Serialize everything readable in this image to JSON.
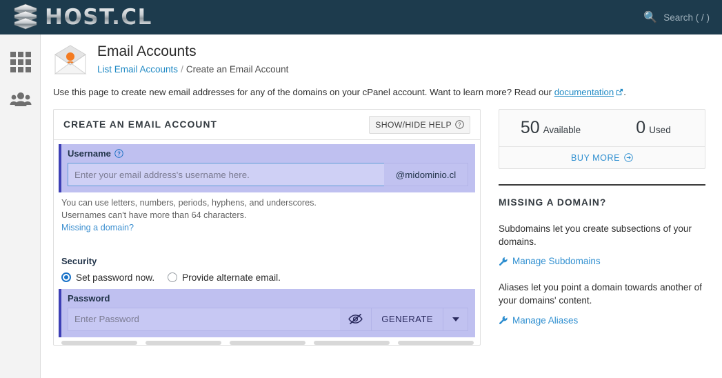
{
  "topbar": {
    "brand": "HOST.CL",
    "logo_icon": "server-stack-logo",
    "search_icon": "search-icon",
    "search_label": "Search ( / )"
  },
  "sidebar": {
    "items": [
      {
        "icon": "apps-grid-icon",
        "name": "sidebar-item-apps"
      },
      {
        "icon": "users-group-icon",
        "name": "sidebar-item-users"
      }
    ]
  },
  "page": {
    "icon": "email-account-envelope-icon",
    "title": "Email Accounts",
    "breadcrumb": {
      "link": "List Email Accounts",
      "separator": "/",
      "current": "Create an Email Account"
    },
    "intro_before": "Use this page to create new email addresses for any of the domains on your cPanel account. Want to learn more? Read our ",
    "intro_link": "documentation",
    "intro_link_icon": "external-link-icon",
    "intro_after": "."
  },
  "form": {
    "card_title": "CREATE AN EMAIL ACCOUNT",
    "help_button": "SHOW/HIDE HELP",
    "help_button_icon": "question-circle-icon",
    "username": {
      "label": "Username",
      "label_icon": "question-circle-icon",
      "placeholder": "Enter your email address's username here.",
      "value": "",
      "domain_suffix": "@midominio.cl"
    },
    "hints": [
      "You can use letters, numbers, periods, hyphens, and underscores.",
      "Usernames can't have more than 64 characters."
    ],
    "missing_domain_link": "Missing a domain?",
    "security": {
      "label": "Security",
      "options": [
        {
          "label": "Set password now.",
          "selected": true
        },
        {
          "label": "Provide alternate email.",
          "selected": false
        }
      ]
    },
    "password": {
      "label": "Password",
      "placeholder": "Enter Password",
      "value": "",
      "toggle_icon": "eye-slash-icon",
      "generate_label": "GENERATE",
      "caret_icon": "chevron-down-icon",
      "strength_segments": 5
    }
  },
  "side": {
    "stats": [
      {
        "number": "50",
        "label": "Available"
      },
      {
        "number": "0",
        "label": "Used"
      }
    ],
    "buy_more": "BUY MORE",
    "buy_more_icon": "arrow-circle-right-icon",
    "missing_title": "MISSING A DOMAIN?",
    "blocks": [
      {
        "text": "Subdomains let you create subsections of your domains.",
        "link": "Manage Subdomains",
        "icon": "wrench-icon"
      },
      {
        "text": "Aliases let you point a domain towards another of your domains' content.",
        "link": "Manage Aliases",
        "icon": "wrench-icon"
      }
    ]
  },
  "colors": {
    "header_bg": "#1d3b4d",
    "accent_link": "#2f8fd0",
    "highlight_bg": "#bfc0f0",
    "highlight_border": "#3d3fb5",
    "radio_on": "#1a73c8",
    "mail_icon_accent": "#f47b20"
  }
}
